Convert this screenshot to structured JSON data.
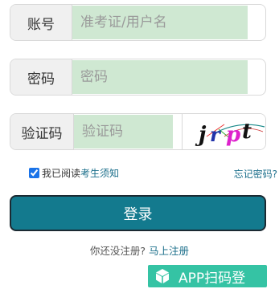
{
  "account": {
    "label": "账号",
    "placeholder": "准考证/用户名"
  },
  "password": {
    "label": "密码",
    "placeholder": "密码"
  },
  "captcha": {
    "label": "验证码",
    "placeholder": "验证码",
    "image_text": "jrpt"
  },
  "agreement": {
    "prefix": "我已阅读",
    "notice_link": "考生须知",
    "checked": true
  },
  "forgot_link": "忘记密码?",
  "login_button": "登录",
  "register": {
    "prompt": "你还没注册?",
    "link": "马上注册"
  },
  "app_login": {
    "label": "APP扫码登",
    "icon": "cube-icon"
  },
  "colors": {
    "primary": "#137a8e",
    "input_bg": "#cfe8d2",
    "app_green": "#35c3a4",
    "link": "#1a6e8a"
  }
}
